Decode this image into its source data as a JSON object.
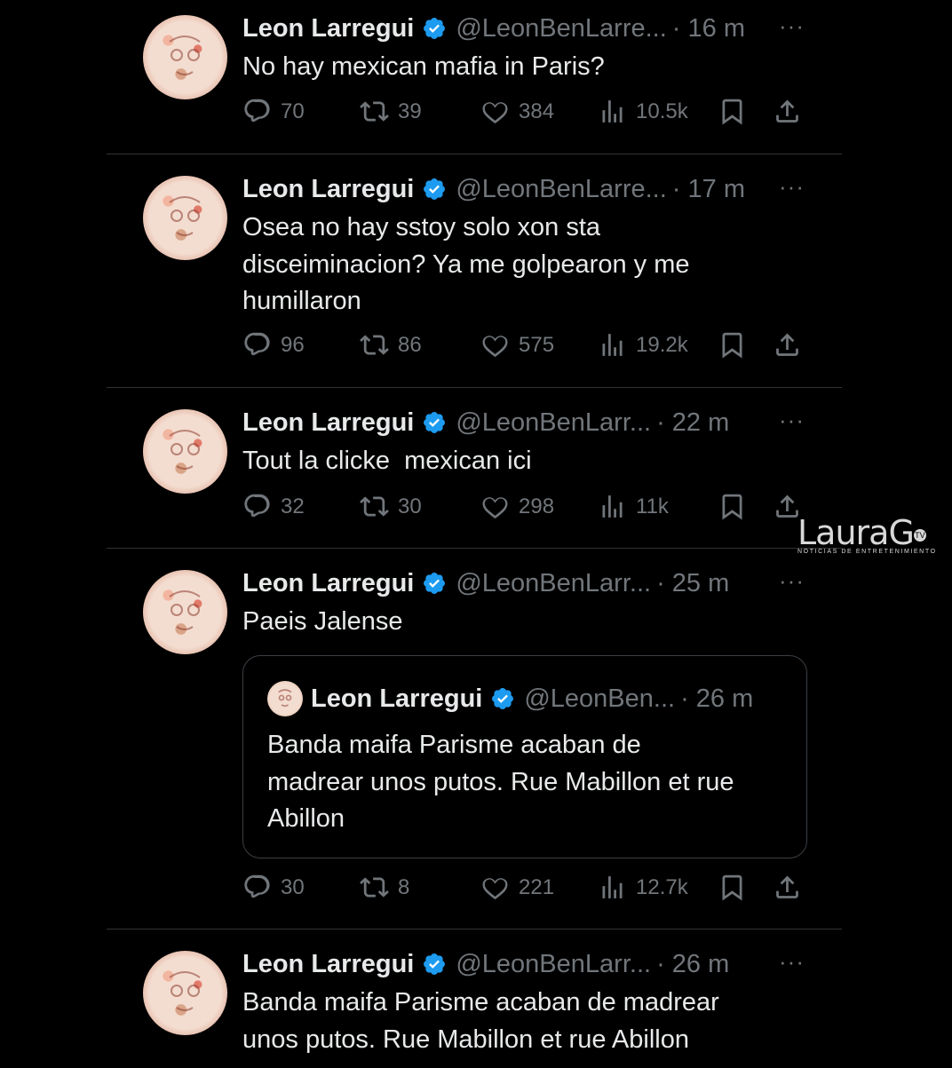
{
  "tweets": [
    {
      "name": "Leon Larregui",
      "handle": "@LeonBenLarre...",
      "time": "· 16 m",
      "more": "···",
      "text": [
        "No hay mexican mafia in Paris?"
      ],
      "stats": {
        "replies": "70",
        "retweets": "39",
        "likes": "384",
        "views": "10.5k"
      }
    },
    {
      "name": "Leon Larregui",
      "handle": "@LeonBenLarre...",
      "time": "· 17 m",
      "more": "···",
      "text": [
        "Osea no hay sstoy solo xon sta",
        "disceiminacion? Ya me golpearon y me",
        "humillaron"
      ],
      "stats": {
        "replies": "96",
        "retweets": "86",
        "likes": "575",
        "views": "19.2k"
      }
    },
    {
      "name": "Leon Larregui",
      "handle": "@LeonBenLarr...",
      "time": "· 22 m",
      "more": "···",
      "text": [
        "Tout la clicke  mexican ici"
      ],
      "stats": {
        "replies": "32",
        "retweets": "30",
        "likes": "298",
        "views": "11k"
      }
    },
    {
      "name": "Leon Larregui",
      "handle": "@LeonBenLarr...",
      "time": "· 25 m",
      "more": "···",
      "text": [
        "Paeis Jalense"
      ],
      "quote": {
        "name": "Leon Larregui",
        "handle": "@LeonBen...",
        "time": "· 26 m",
        "text": [
          "Banda maifa Parisme acaban de",
          "madrear unos putos. Rue Mabillon et rue",
          "Abillon"
        ]
      },
      "stats": {
        "replies": "30",
        "retweets": "8",
        "likes": "221",
        "views": "12.7k"
      }
    },
    {
      "name": "Leon Larregui",
      "handle": "@LeonBenLarr...",
      "time": "· 26 m",
      "more": "···",
      "text": [
        "Banda maifa Parisme acaban de madrear",
        "unos putos. Rue Mabillon et rue Abillon"
      ]
    }
  ],
  "watermark": {
    "main": "LauraG",
    "badge": "TV",
    "sub": "NOTICIAS DE ENTRETENIMIENTO"
  },
  "colors": {
    "background": "#000000",
    "text": "#e7e9ea",
    "muted": "#71767b",
    "verified": "#1d9bf0",
    "divider": "#2f3336"
  }
}
